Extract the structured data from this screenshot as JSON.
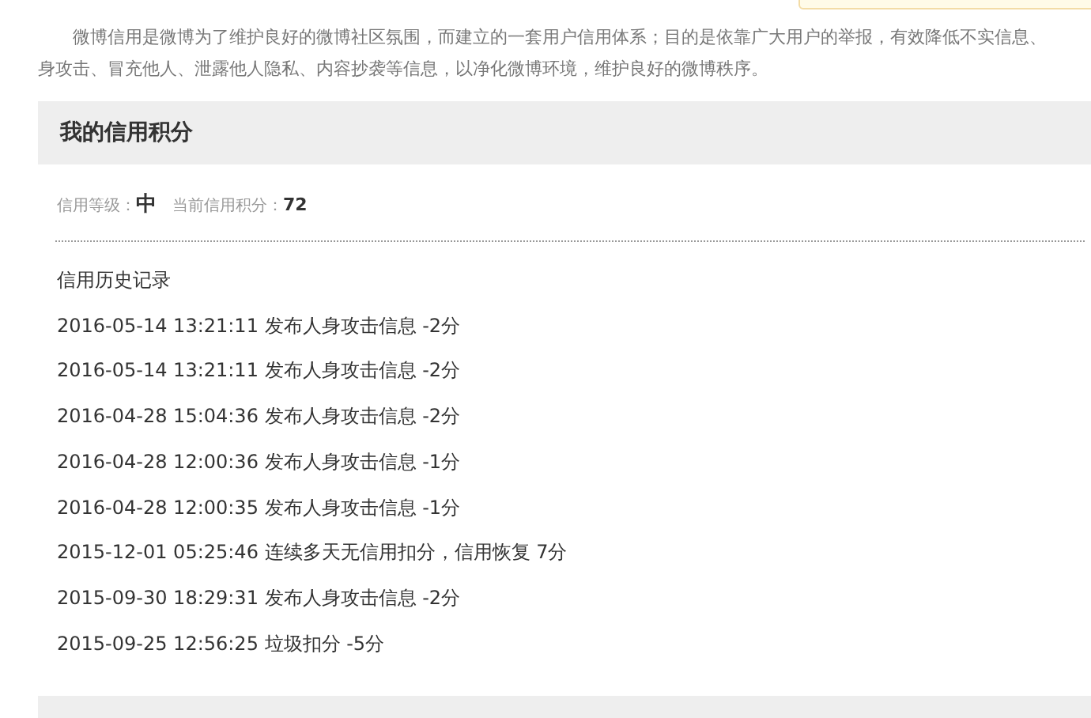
{
  "intro": {
    "lines": [
      "微博信用是微博为了维护良好的微博社区氛围，而建立的一套用户信用体系；目的是依靠广大用户的举报，有效降低不实信息、",
      "身攻击、冒充他人、泄露他人隐私、内容抄袭等信息，以净化微博环境，维护良好的微博秩序。"
    ]
  },
  "section": {
    "title": "我的信用积分"
  },
  "summary": {
    "level_label": "信用等级：",
    "level": "中",
    "score_label": "当前信用积分：",
    "score": "72"
  },
  "history": {
    "title": "信用历史记录",
    "records": [
      {
        "time": "2016-05-14 13:21:11",
        "text": "发布人身攻击信息 -2分"
      },
      {
        "time": "2016-05-14 13:21:11",
        "text": "发布人身攻击信息 -2分"
      },
      {
        "time": "2016-04-28 15:04:36",
        "text": "发布人身攻击信息 -2分"
      },
      {
        "time": "2016-04-28 12:00:36",
        "text": "发布人身攻击信息 -1分"
      },
      {
        "time": "2016-04-28 12:00:35",
        "text": "发布人身攻击信息 -1分"
      },
      {
        "time": "2015-12-01 05:25:46",
        "text": "连续多天无信用扣分，信用恢复 7分"
      },
      {
        "time": "2015-09-30 18:29:31",
        "text": "发布人身攻击信息 -2分"
      },
      {
        "time": "2015-09-25 12:56:25",
        "text": "垃圾扣分 -5分"
      }
    ]
  }
}
